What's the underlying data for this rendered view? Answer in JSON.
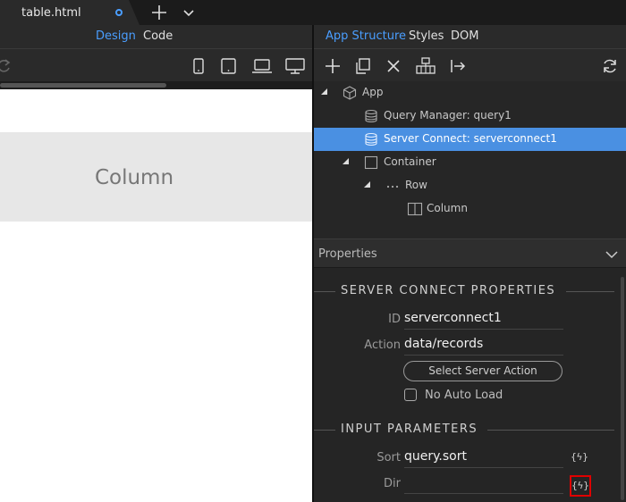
{
  "tabbar": {
    "file_name": "table.html"
  },
  "left_panel": {
    "modes": [
      "Design",
      "Code"
    ],
    "canvas": {
      "column_label": "Column"
    }
  },
  "right_panel": {
    "tabs": [
      "App Structure",
      "Styles",
      "DOM"
    ],
    "tree": [
      {
        "label": "App",
        "icon": "cube-icon"
      },
      {
        "label": "Query Manager: query1",
        "icon": "database-icon"
      },
      {
        "label": "Server Connect: serverconnect1",
        "icon": "database-icon",
        "selected": true
      },
      {
        "label": "Container",
        "icon": "container-icon"
      },
      {
        "label": "Row",
        "icon": "dots-icon"
      },
      {
        "label": "Column",
        "icon": "column-icon"
      }
    ],
    "properties": {
      "title": "Properties",
      "section1": "SERVER CONNECT PROPERTIES",
      "id_label": "ID",
      "id_value": "serverconnect1",
      "action_label": "Action",
      "action_value": "data/records",
      "select_button": "Select Server Action",
      "no_auto_load": "No Auto Load",
      "section2": "INPUT PARAMETERS",
      "sort_label": "Sort",
      "sort_value": "query.sort",
      "dir_label": "Dir",
      "dir_value": "",
      "dynamic_glyph": "{ϟ}"
    }
  },
  "colors": {
    "accent": "#4a9eff",
    "selection": "#4a90e2",
    "highlight_box": "#e00000"
  }
}
